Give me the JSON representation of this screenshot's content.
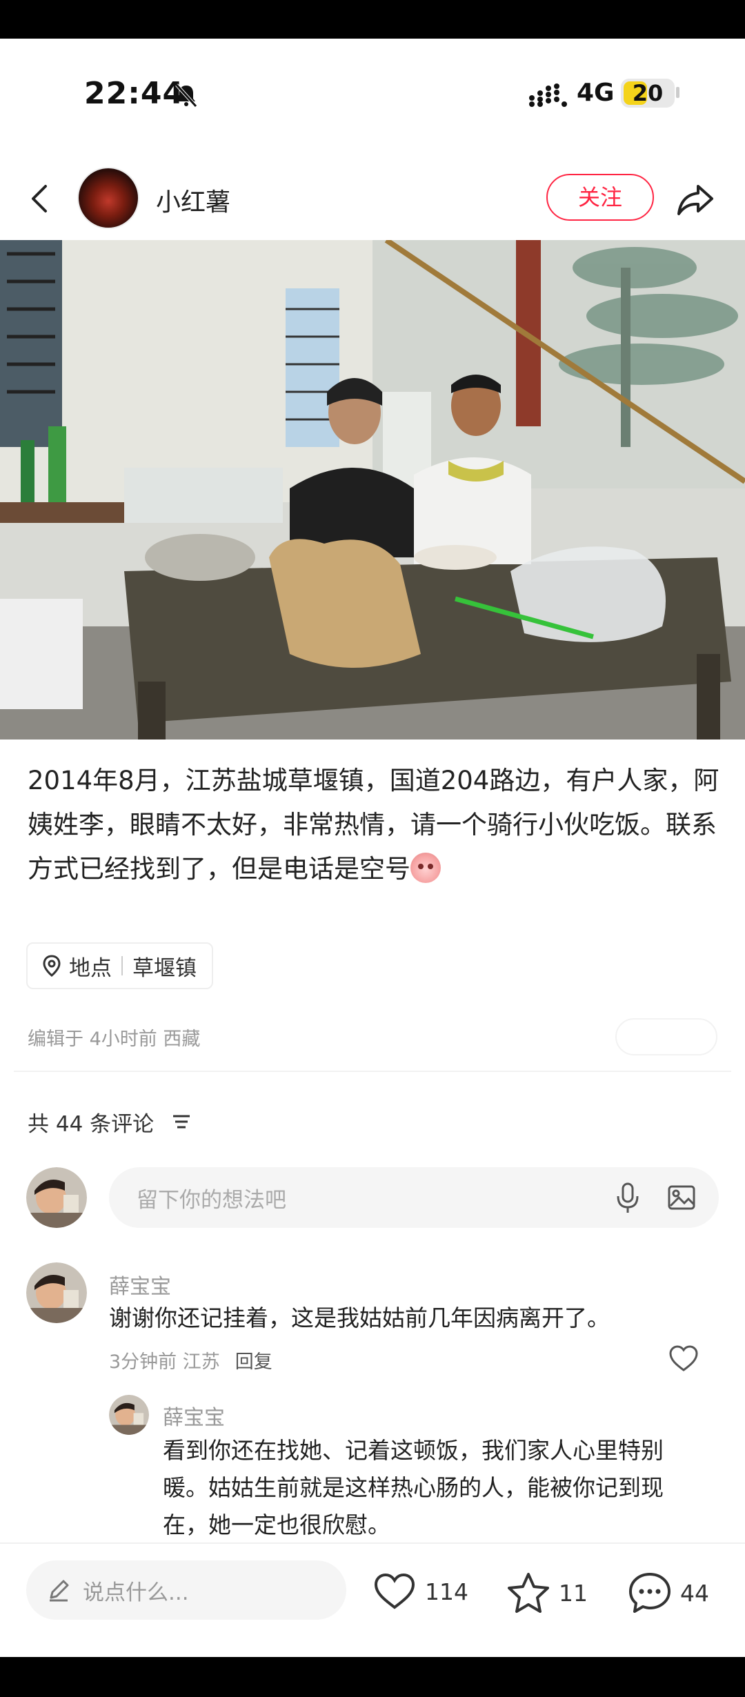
{
  "status_bar": {
    "time": "22:44",
    "network": "4G",
    "battery_level": "20"
  },
  "header": {
    "author_name": "小红薯",
    "follow_label": "关注"
  },
  "post": {
    "text_main": "2014年8月，江苏盐城草堰镇，国道204路边，有户人家，阿姨姓李，眼睛不太好，非常热情，请一个骑行小伙吃饭。联系方式已经找到了，但是电话是空号",
    "location_label": "地点",
    "location_name": "草堰镇",
    "edit_meta": "编辑于 4小时前 西藏"
  },
  "comments": {
    "count_label": "共 44 条评论",
    "input_placeholder": "留下你的想法吧",
    "items": [
      {
        "name": "薛宝宝",
        "text": "谢谢你还记挂着，这是我姑姑前几年因病离开了。",
        "time_location": "3分钟前 江苏",
        "reply_label": "回复"
      }
    ],
    "reply": {
      "name": "薛宝宝",
      "text": "看到你还在找她、记着这顿饭，我们家人心里特别暖。姑姑生前就是这样热心肠的人，能被你记到现在，她一定也很欣慰。"
    }
  },
  "bottom_bar": {
    "say_placeholder": "说点什么...",
    "likes": "114",
    "collects": "11",
    "comments": "44"
  },
  "colors": {
    "accent": "#ff2442",
    "battery": "#f4d31a"
  }
}
